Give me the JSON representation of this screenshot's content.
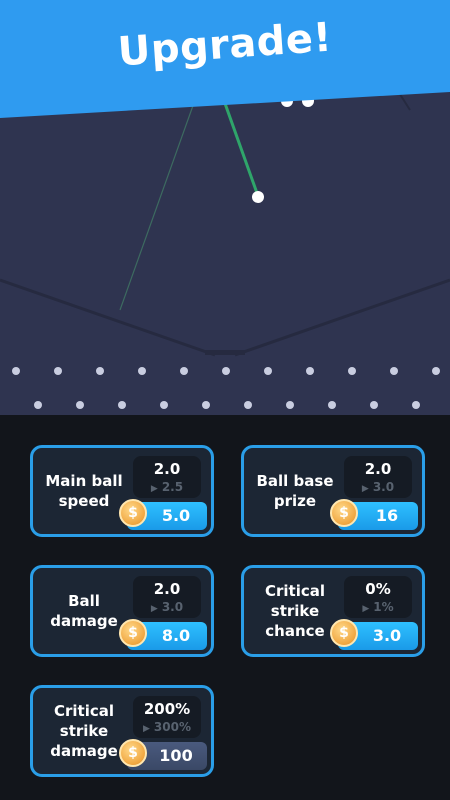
{
  "banner": {
    "title": "Upgrade!"
  },
  "currency_symbol": "$",
  "upgrades": [
    {
      "label": "Main ball speed",
      "current": "2.0",
      "next": "2.5",
      "price": "5.0",
      "affordable": true
    },
    {
      "label": "Ball base prize",
      "current": "2.0",
      "next": "3.0",
      "price": "16",
      "affordable": true
    },
    {
      "label": "Ball damage",
      "current": "2.0",
      "next": "3.0",
      "price": "8.0",
      "affordable": true
    },
    {
      "label": "Critical strike chance",
      "current": "0%",
      "next": "1%",
      "price": "3.0",
      "affordable": true
    },
    {
      "label": "Critical strike damage",
      "current": "200%",
      "next": "300%",
      "price": "100",
      "affordable": false
    }
  ],
  "colors": {
    "banner": "#2f9bf0",
    "card_border": "#2a9ee8",
    "button": "#2ec0ff",
    "button_disabled": "#4a5a7e",
    "coin": "#f0a640"
  }
}
